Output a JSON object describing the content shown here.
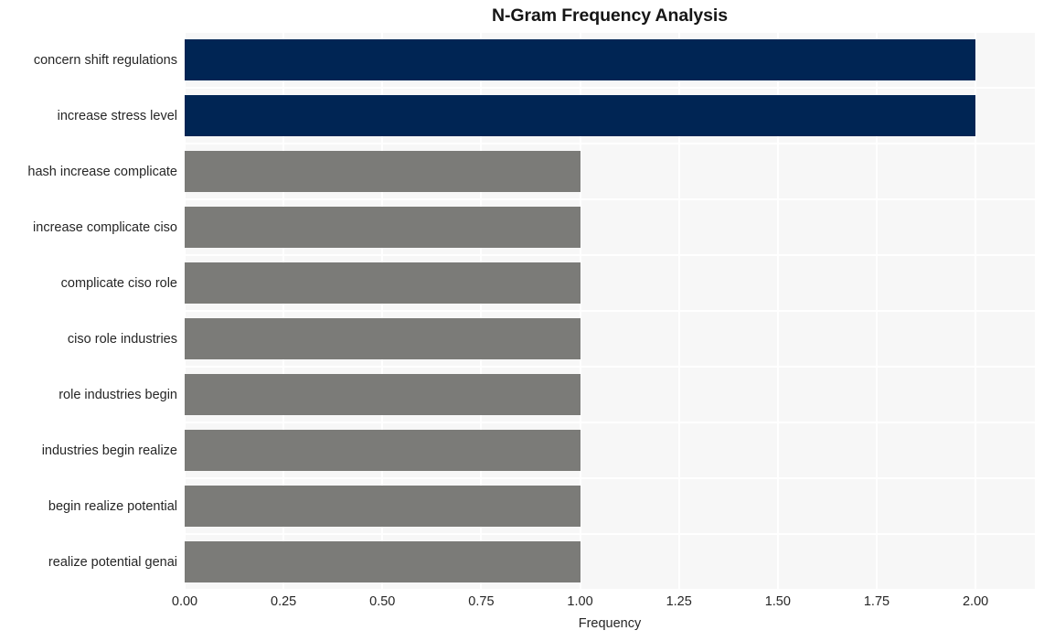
{
  "chart_data": {
    "type": "bar",
    "orientation": "horizontal",
    "title": "N-Gram Frequency Analysis",
    "xlabel": "Frequency",
    "ylabel": "",
    "categories": [
      "concern shift regulations",
      "increase stress level",
      "hash increase complicate",
      "increase complicate ciso",
      "complicate ciso role",
      "ciso role industries",
      "role industries begin",
      "industries begin realize",
      "begin realize potential",
      "realize potential genai"
    ],
    "values": [
      2,
      2,
      1,
      1,
      1,
      1,
      1,
      1,
      1,
      1
    ],
    "bar_colors": [
      "#002554",
      "#002554",
      "#7b7b78",
      "#7b7b78",
      "#7b7b78",
      "#7b7b78",
      "#7b7b78",
      "#7b7b78",
      "#7b7b78",
      "#7b7b78"
    ],
    "xlim": [
      0,
      2.15
    ],
    "xticks": [
      0,
      0.25,
      0.5,
      0.75,
      1,
      1.25,
      1.5,
      1.75,
      2
    ],
    "xticklabels": [
      "0.00",
      "0.25",
      "0.50",
      "0.75",
      "1.00",
      "1.25",
      "1.50",
      "1.75",
      "2.00"
    ],
    "grid": true,
    "grid_color": "#ffffff",
    "plot_background": "#f7f7f7",
    "figure_background": "#ffffff",
    "legend": null,
    "colors": {
      "highlight": "#002554",
      "default": "#7b7b78",
      "text": "#262626",
      "title": "#161616"
    }
  }
}
